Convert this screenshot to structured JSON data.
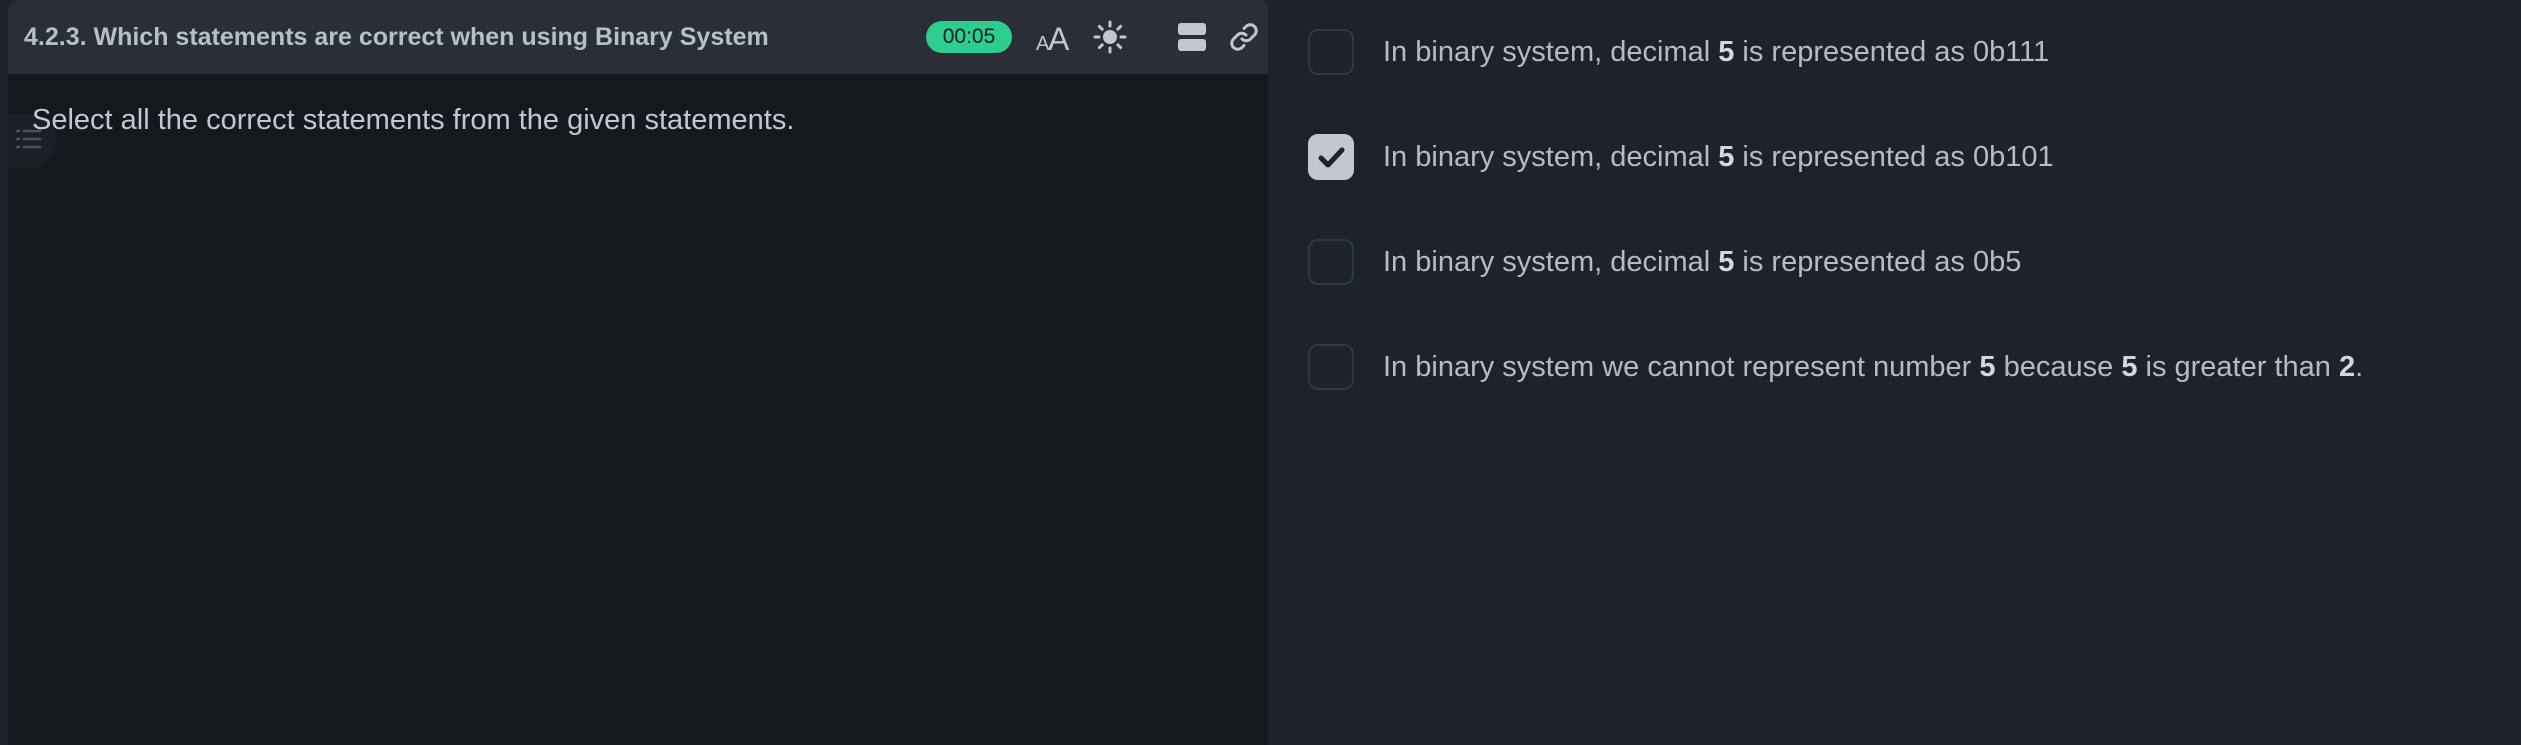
{
  "header": {
    "title": "4.2.3. Which statements are correct when using Binary System",
    "timer": "00:05"
  },
  "icons": {
    "font_size": "font-size-icon",
    "theme": "sun-icon",
    "layout": "layout-icon",
    "link": "link-icon",
    "toc": "list-icon",
    "check": "checkmark-icon"
  },
  "question": {
    "prompt": "Select all the correct statements from the given statements."
  },
  "options": [
    {
      "checked": false,
      "parts": [
        "In binary system, decimal ",
        "5",
        " is represented as 0b111"
      ]
    },
    {
      "checked": true,
      "parts": [
        "In binary system, decimal ",
        "5",
        " is represented as 0b101"
      ]
    },
    {
      "checked": false,
      "parts": [
        "In binary system, decimal ",
        "5",
        " is represented as 0b5"
      ]
    },
    {
      "checked": false,
      "parts": [
        "In binary system we cannot represent number ",
        "5",
        " because ",
        "5",
        " is greater than ",
        "2",
        "."
      ]
    }
  ],
  "colors": {
    "timer_bg": "#2ecc8f",
    "checked_bg": "#c3c8d0",
    "panel_bg": "#15181c",
    "page_bg": "#1e232a"
  }
}
